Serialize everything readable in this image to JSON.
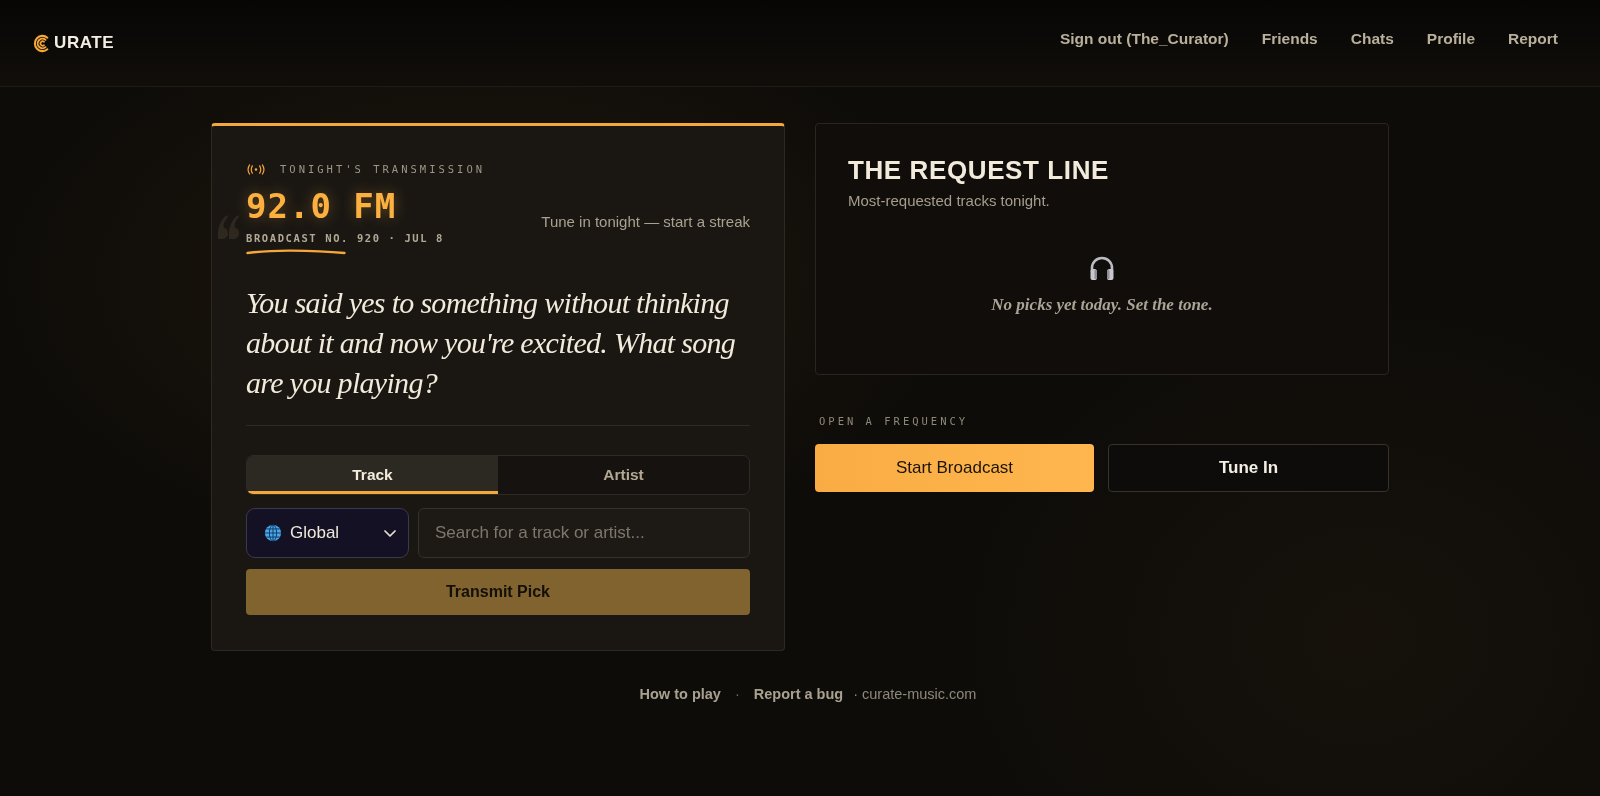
{
  "header": {
    "logo": {
      "text": "URATE"
    },
    "nav": [
      "Sign out (The_Curator)",
      "Friends",
      "Chats",
      "Profile",
      "Report"
    ]
  },
  "transmission": {
    "kicker": "TONIGHT'S TRANSMISSION",
    "frequency": "92.0 FM",
    "broadcast_line": "BROADCAST NO. 920 · JUL 8",
    "streak_hint": "Tune in tonight — start a streak",
    "question": "You said yes to something without thinking about it and now you're excited. What song are you playing?",
    "tabs": [
      {
        "label": "Track",
        "selected": true
      },
      {
        "label": "Artist",
        "selected": false
      }
    ],
    "region_select": {
      "value": "Global"
    },
    "search": {
      "placeholder": "Search for a track or artist..."
    },
    "submit": {
      "label": "Transmit Pick",
      "disabled": true
    }
  },
  "request_line": {
    "title": "THE REQUEST LINE",
    "subtitle": "Most-requested tracks tonight.",
    "empty_message": "No picks yet today. Set the tone."
  },
  "open_frequency": {
    "label": "OPEN A FREQUENCY",
    "buttons": [
      {
        "label": "Start Broadcast",
        "kind": "primary"
      },
      {
        "label": "Tune In",
        "kind": "secondary"
      }
    ]
  },
  "footer": [
    {
      "kind": "link",
      "text": "How to play"
    },
    {
      "kind": "separator",
      "text": "·"
    },
    {
      "kind": "link",
      "text": "Report a bug"
    },
    {
      "kind": "note",
      "text": "· curate-music.com"
    }
  ]
}
